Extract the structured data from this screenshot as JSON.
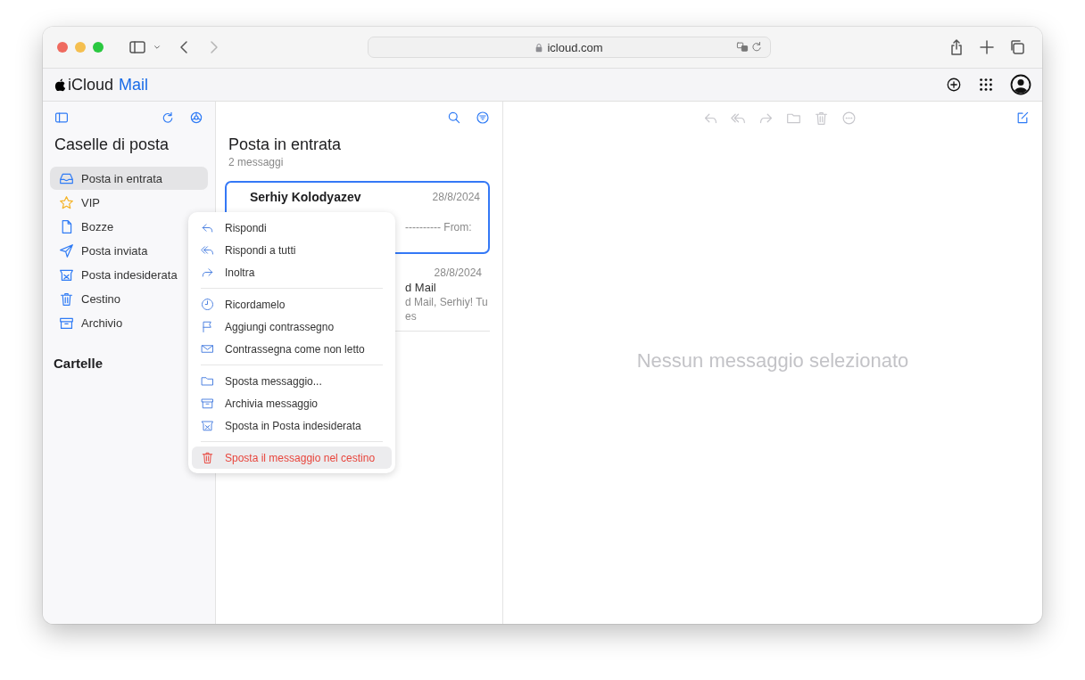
{
  "browser": {
    "url": "icloud.com"
  },
  "app": {
    "brand": "iCloud",
    "product": "Mail"
  },
  "sidebar": {
    "title": "Caselle di posta",
    "mailboxes": [
      {
        "label": "Posta in entrata",
        "kind": "inbox",
        "selected": true
      },
      {
        "label": "VIP",
        "kind": "star",
        "selected": false
      },
      {
        "label": "Bozze",
        "kind": "document",
        "selected": false
      },
      {
        "label": "Posta inviata",
        "kind": "send",
        "selected": false
      },
      {
        "label": "Posta indesiderata",
        "kind": "junk",
        "selected": false
      },
      {
        "label": "Cestino",
        "kind": "trash",
        "selected": false
      },
      {
        "label": "Archivio",
        "kind": "archive",
        "selected": false
      }
    ],
    "folders_heading": "Cartelle"
  },
  "message_list": {
    "title": "Posta in entrata",
    "count": "2 messaggi",
    "messages": [
      {
        "sender": "Serhiy Kolodyazev",
        "date": "28/8/2024",
        "selected": true,
        "visible_lines": [
          "---------- From:"
        ]
      },
      {
        "date": "28/8/2024",
        "selected": false,
        "visible_lines": [
          "d Mail",
          "d Mail, Serhiy! Tu",
          "es"
        ]
      }
    ]
  },
  "reader": {
    "empty_text": "Nessun messaggio selezionato"
  },
  "context_menu": {
    "groups": [
      [
        {
          "label": "Rispondi",
          "kind": "reply",
          "destructive": false,
          "selected": false
        },
        {
          "label": "Rispondi a tutti",
          "kind": "reply-all",
          "destructive": false,
          "selected": false
        },
        {
          "label": "Inoltra",
          "kind": "forward",
          "destructive": false,
          "selected": false
        }
      ],
      [
        {
          "label": "Ricordamelo",
          "kind": "clock",
          "destructive": false,
          "selected": false
        },
        {
          "label": "Aggiungi contrassegno",
          "kind": "flag",
          "destructive": false,
          "selected": false
        },
        {
          "label": "Contrassegna come non letto",
          "kind": "unread",
          "destructive": false,
          "selected": false
        }
      ],
      [
        {
          "label": "Sposta messaggio...",
          "kind": "folder",
          "destructive": false,
          "selected": false
        },
        {
          "label": "Archivia messaggio",
          "kind": "archive",
          "destructive": false,
          "selected": false
        },
        {
          "label": "Sposta in Posta indesiderata",
          "kind": "junk",
          "destructive": false,
          "selected": false
        }
      ],
      [
        {
          "label": "Sposta il messaggio nel cestino",
          "kind": "trash",
          "destructive": true,
          "selected": true
        }
      ]
    ]
  }
}
